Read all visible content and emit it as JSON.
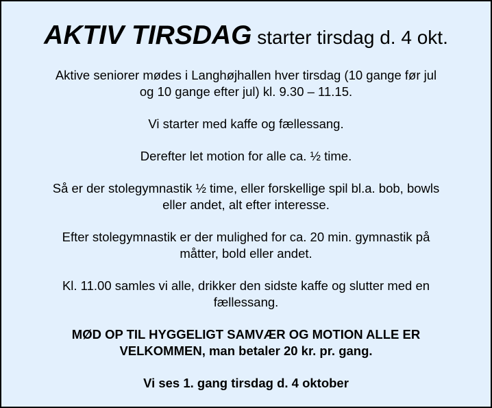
{
  "title": {
    "main": "AKTIV TIRSDAG",
    "sub": " starter tirsdag d. 4 okt."
  },
  "paragraphs": [
    {
      "lines": [
        "Aktive seniorer mødes i Langhøjhallen hver tirsdag (10 gange før jul",
        "og 10 gange efter jul)  kl. 9.30 – 11.15."
      ]
    },
    {
      "lines": [
        "Vi starter med kaffe og fællessang."
      ]
    },
    {
      "lines": [
        "Derefter let motion for alle ca. ½ time."
      ]
    },
    {
      "lines": [
        "Så er der stolegymnastik ½ time, eller forskellige spil bl.a. bob, bowls",
        "eller andet, alt efter interesse."
      ]
    },
    {
      "lines": [
        "Efter stolegymnastik er der mulighed for ca. 20 min. gymnastik på",
        "måtter, bold eller andet."
      ]
    },
    {
      "lines": [
        "Kl. 11.00 samles vi alle, drikker den sidste kaffe og slutter med en",
        "fællessang."
      ]
    },
    {
      "lines": [
        "MØD OP TIL HYGGELIGT SAMVÆR OG MOTION ALLE ER",
        "VELKOMMEN, man betaler 20 kr. pr. gang."
      ]
    },
    {
      "lines": [
        "Vi ses 1. gang tirsdag d. 4 oktober"
      ]
    }
  ]
}
